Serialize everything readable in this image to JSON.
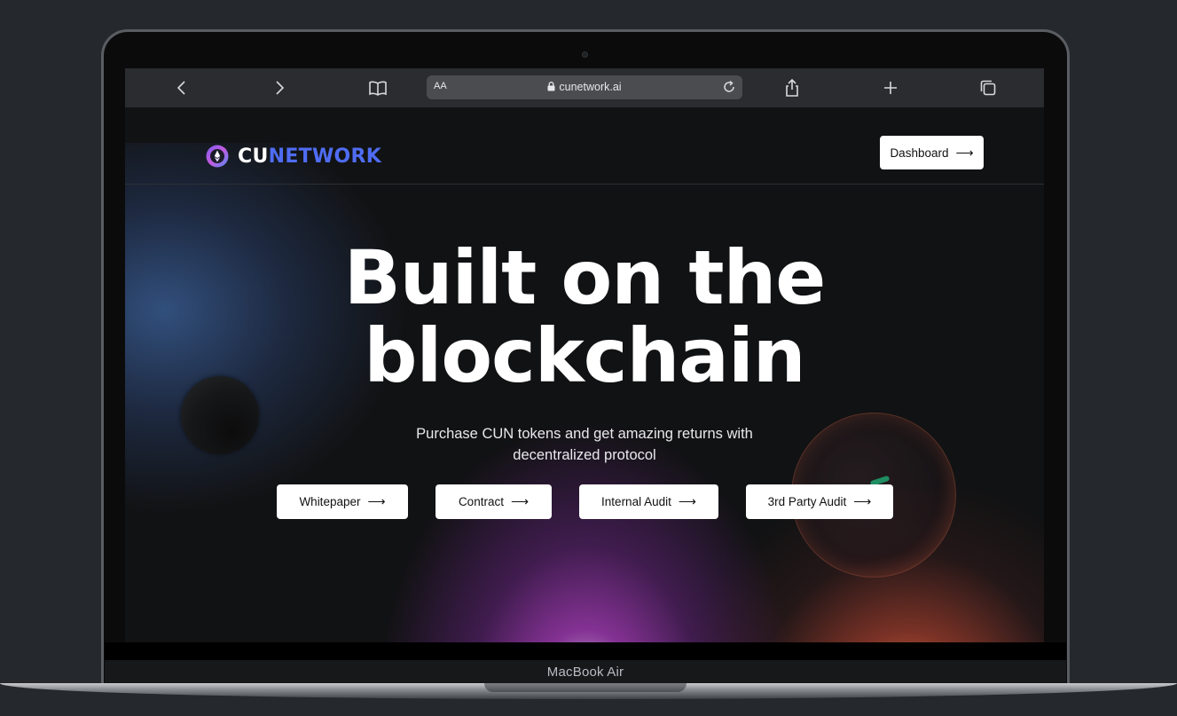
{
  "browser": {
    "text_size_label": "AA",
    "url": "cunetwork.ai"
  },
  "nav": {
    "logo_prefix": "CU",
    "logo_suffix": "NETWORK",
    "dashboard_label": "Dashboard"
  },
  "hero": {
    "title_line1": "Built on the",
    "title_line2": "blockchain",
    "subtitle_line1": "Purchase CUN tokens and get amazing returns with",
    "subtitle_line2": "decentralized protocol",
    "buttons": [
      {
        "label": "Whitepaper"
      },
      {
        "label": "Contract"
      },
      {
        "label": "Internal Audit"
      },
      {
        "label": "3rd Party Audit"
      }
    ]
  },
  "device": {
    "model_label": "MacBook Air"
  },
  "colors": {
    "brand_blue": "#4f6cf2",
    "page_bg": "#111213",
    "button_bg": "#ffffff"
  }
}
